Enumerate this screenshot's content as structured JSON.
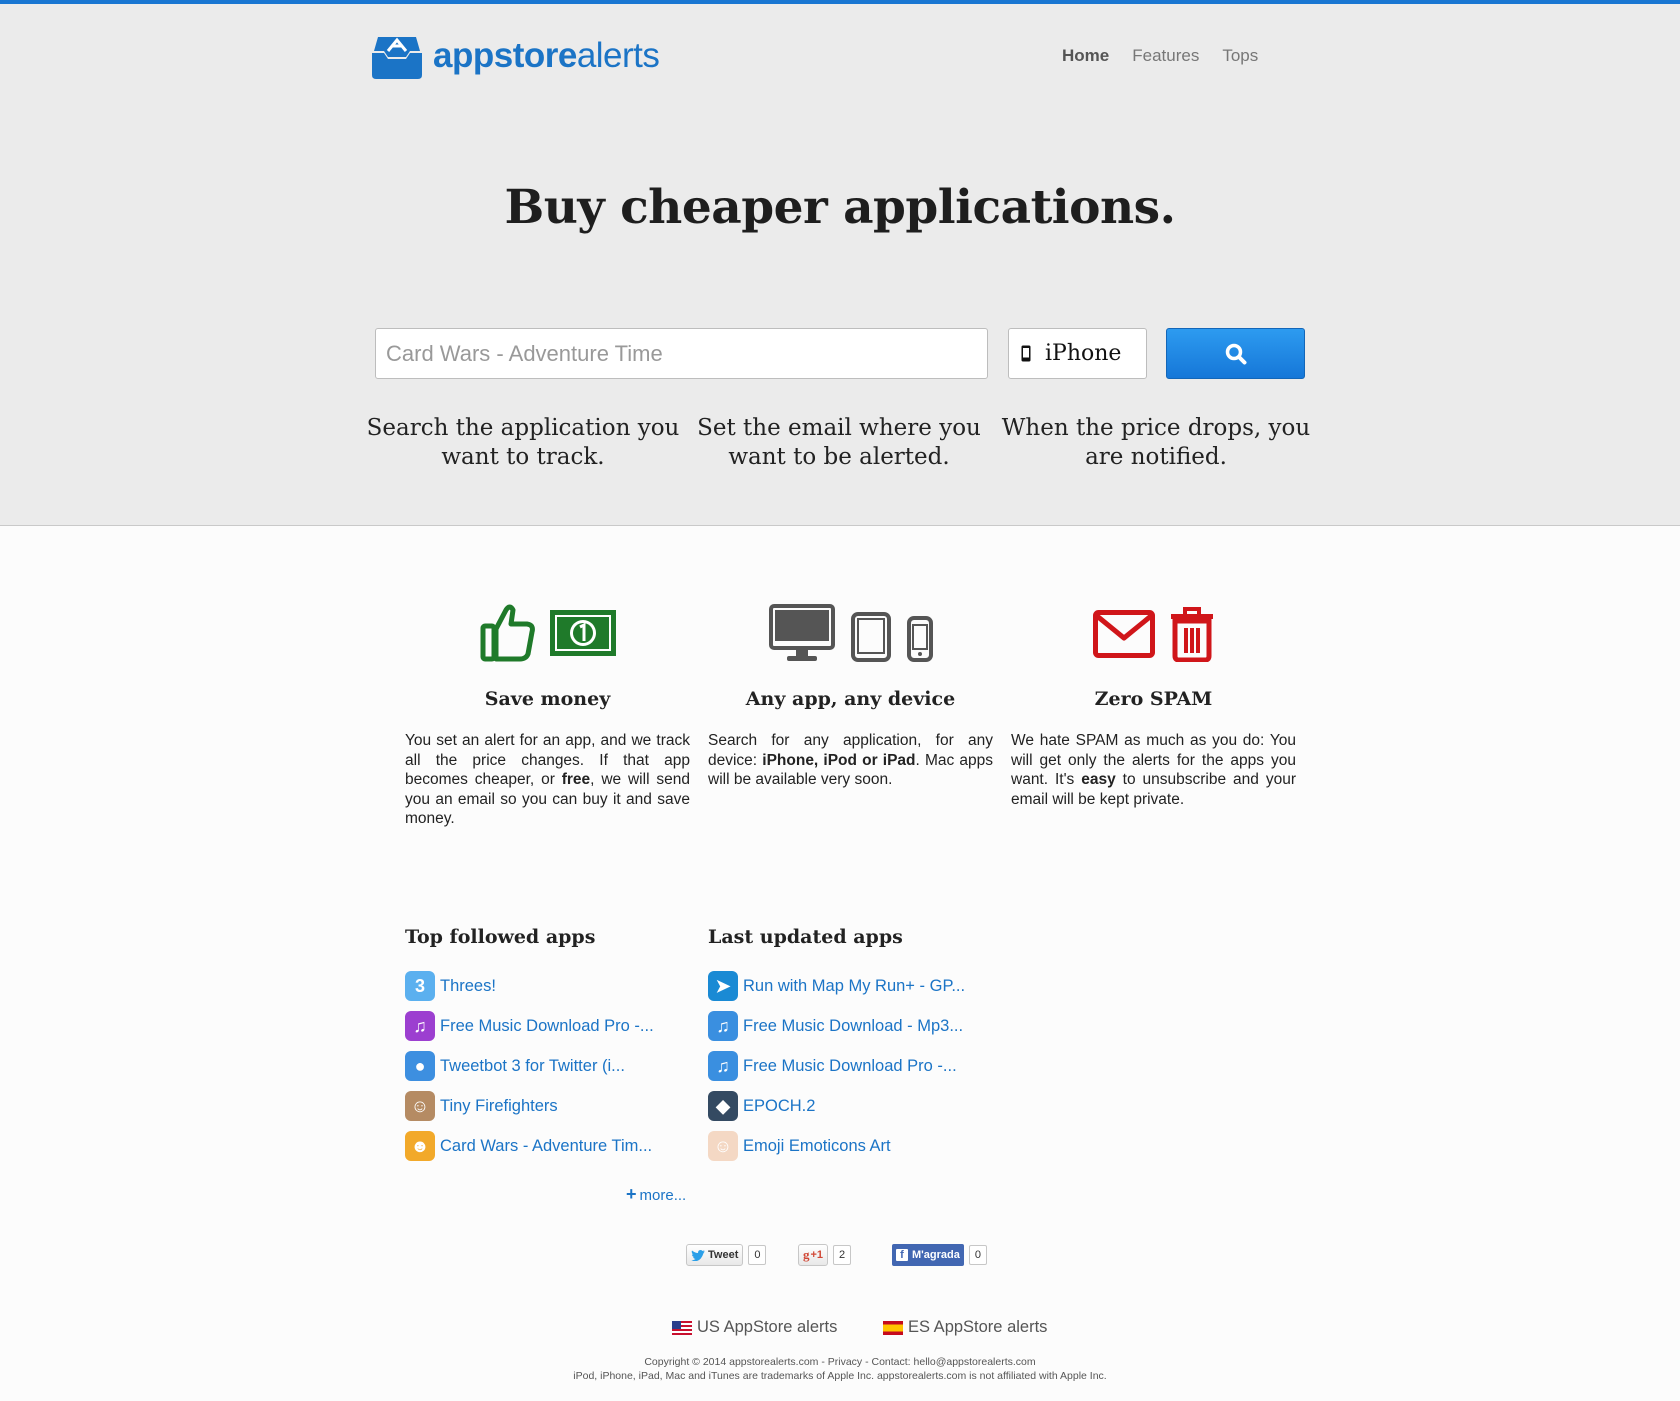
{
  "brand": {
    "logo_bold": "appstore",
    "logo_regular": "alerts",
    "color": "#1b74c6"
  },
  "nav": {
    "items": [
      "Home",
      "Features",
      "Tops"
    ],
    "active": "Home"
  },
  "hero": {
    "headline": "Buy cheaper applications.",
    "search": {
      "placeholder": "Card Wars - Adventure Time",
      "value": ""
    },
    "device": {
      "label": "iPhone",
      "icon": "mobile-phone-icon"
    },
    "search_button_icon": "search-icon",
    "steps": [
      "Search the application you want to track.",
      "Set the email where you want to be alerted.",
      "When the price drops, you are notified."
    ]
  },
  "features": [
    {
      "title": "Save money",
      "icons": [
        "thumbs-up-icon",
        "money-bill-icon"
      ],
      "color": "#1f7a2a",
      "text": [
        {
          "t": "You set an alert for an app, and we track all the price changes. If that app becomes cheaper, or "
        },
        {
          "t": "free",
          "b": true
        },
        {
          "t": ", we will send you an email so you can buy it and save money."
        }
      ]
    },
    {
      "title": "Any app, any device",
      "icons": [
        "desktop-icon",
        "tablet-icon",
        "phone-icon"
      ],
      "color": "#555555",
      "text": [
        {
          "t": "Search for any application, for any device: "
        },
        {
          "t": "iPhone, iPod",
          "b": true
        },
        {
          "t": " or ",
          "b": true
        },
        {
          "t": "iPad",
          "b": true
        },
        {
          "t": ". Mac apps will be available very soon."
        }
      ]
    },
    {
      "title": "Zero SPAM",
      "icons": [
        "envelope-icon",
        "trash-icon"
      ],
      "color": "#d0161a",
      "text": [
        {
          "t": "We hate SPAM as much as you do: You will get only the alerts for the apps you want. It's "
        },
        {
          "t": "easy",
          "b": true
        },
        {
          "t": " to unsubscribe and your email will be kept private."
        }
      ]
    }
  ],
  "top_followed": {
    "title": "Top followed apps",
    "apps": [
      {
        "name": "Threes!",
        "icon_color": "#5bb0ef",
        "glyph": "3"
      },
      {
        "name": "Free Music Download Pro -...",
        "icon_color": "#9c3fd0",
        "glyph": "♫"
      },
      {
        "name": "Tweetbot 3 for Twitter (i...",
        "icon_color": "#3d8fe0",
        "glyph": "●"
      },
      {
        "name": "Tiny Firefighters",
        "icon_color": "#b58b63",
        "glyph": "☺"
      },
      {
        "name": "Card Wars - Adventure Tim...",
        "icon_color": "#f2a92a",
        "glyph": "☻"
      }
    ],
    "more": "more..."
  },
  "last_updated": {
    "title": "Last updated apps",
    "apps": [
      {
        "name": "Run with Map My Run+ - GP...",
        "icon_color": "#1a8ad4",
        "glyph": "➤"
      },
      {
        "name": "Free Music Download - Mp3...",
        "icon_color": "#3a8fe0",
        "glyph": "♫"
      },
      {
        "name": "Free Music Download Pro -...",
        "icon_color": "#3a8fe0",
        "glyph": "♫"
      },
      {
        "name": "EPOCH.2",
        "icon_color": "#344a62",
        "glyph": "◆"
      },
      {
        "name": "Emoji Emoticons Art",
        "icon_color": "#f4d8c4",
        "glyph": "☺"
      }
    ]
  },
  "social": {
    "tweet": {
      "label": "Tweet",
      "count": "0"
    },
    "gplus": {
      "label": "+1",
      "count": "2"
    },
    "facebook": {
      "label": "M'agrada",
      "count": "0"
    }
  },
  "locales": [
    {
      "label": "US AppStore alerts",
      "flag": "us-flag"
    },
    {
      "label": "ES AppStore alerts",
      "flag": "es-flag"
    }
  ],
  "footer": {
    "copyright": "Copyright © 2014 appstorealerts.com - Privacy - Contact: hello@appstorealerts.com",
    "disclaimer": "iPod, iPhone, iPad, Mac and iTunes are trademarks of Apple Inc. appstorealerts.com is not affiliated with Apple Inc."
  }
}
